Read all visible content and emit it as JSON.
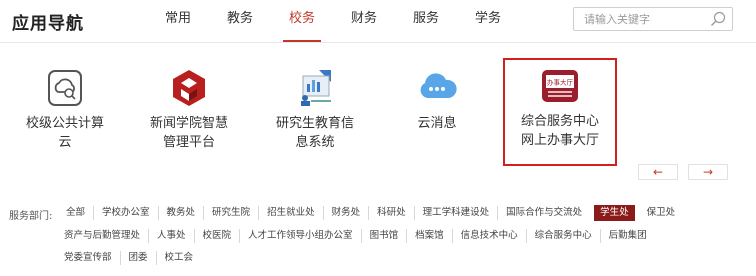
{
  "header": {
    "title": "应用导航",
    "search_placeholder": "请输入关键字"
  },
  "nav": {
    "tabs": [
      {
        "label": "常用"
      },
      {
        "label": "教务"
      },
      {
        "label": "校务"
      },
      {
        "label": "财务"
      },
      {
        "label": "服务"
      },
      {
        "label": "学务"
      }
    ],
    "active": "校务"
  },
  "apps": [
    {
      "label1": "校级公共计算",
      "label2": "云",
      "icon": "cloud-computing-icon"
    },
    {
      "label1": "新闻学院智慧",
      "label2": "管理平台",
      "icon": "hexagon-logo-icon"
    },
    {
      "label1": "研究生教育信",
      "label2": "息系统",
      "icon": "graduate-system-icon"
    },
    {
      "label1": "云消息",
      "label2": "",
      "icon": "cloud-message-icon"
    },
    {
      "label1": "综合服务中心",
      "label2": "网上办事大厅",
      "icon": "service-hall-icon",
      "icon_text": "办事大厅"
    }
  ],
  "pager": {
    "prev": "←",
    "next": "→"
  },
  "departments": {
    "label": "服务部门:",
    "row1": [
      "全部",
      "学校办公室",
      "教务处",
      "研究生院",
      "招生就业处",
      "财务处",
      "科研处",
      "理工学科建设处",
      "国际合作与交流处",
      "学生处",
      "保卫处"
    ],
    "row2": [
      "资产与后勤管理处",
      "人事处",
      "校医院",
      "人才工作领导小组办公室",
      "图书馆",
      "档案馆",
      "信息技术中心",
      "综合服务中心",
      "后勤集团"
    ],
    "row3": [
      "党委宣传部",
      "团委",
      "校工会"
    ],
    "active": "学生处"
  },
  "colors": {
    "accent": "#c0392b",
    "highlight_border": "#d0211c",
    "active_dept_bg": "#8b1a1a"
  }
}
